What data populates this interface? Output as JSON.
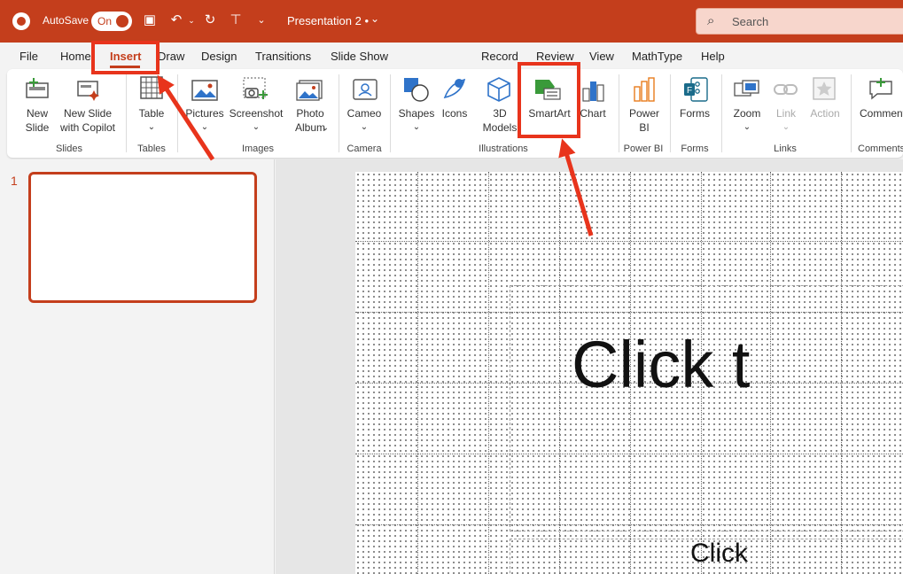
{
  "titlebar": {
    "autosave_label": "AutoSave",
    "autosave_state": "On",
    "title": "Presentation 2 •",
    "search_placeholder": "Search"
  },
  "tabs": [
    {
      "label": "File"
    },
    {
      "label": "Home"
    },
    {
      "label": "Insert",
      "active": true
    },
    {
      "label": "Draw"
    },
    {
      "label": "Design"
    },
    {
      "label": "Transitions"
    },
    {
      "label": "Slide Show"
    },
    {
      "label": "Record"
    },
    {
      "label": "Review"
    },
    {
      "label": "View"
    },
    {
      "label": "MathType"
    },
    {
      "label": "Help"
    }
  ],
  "ribbon": {
    "new_slide": "New\nSlide",
    "new_slide_copilot": "New Slide\nwith Copilot",
    "table": "Table",
    "pictures": "Pictures",
    "screenshot": "Screenshot",
    "photo_album": "Photo\nAlbum",
    "cameo": "Cameo",
    "shapes": "Shapes",
    "icons": "Icons",
    "models_3d": "3D\nModels",
    "smartart": "SmartArt",
    "chart": "Chart",
    "power_bi": "Power\nBI",
    "forms": "Forms",
    "zoom": "Zoom",
    "link": "Link",
    "action": "Action",
    "comment": "Comment",
    "groups": {
      "slides": "Slides",
      "tables": "Tables",
      "images": "Images",
      "camera": "Camera",
      "illustrations": "Illustrations",
      "power_bi": "Power BI",
      "forms": "Forms",
      "links": "Links",
      "comments": "Comments"
    }
  },
  "thumbnails": {
    "slide_number": "1"
  },
  "slide": {
    "title_placeholder": "Click t",
    "subtitle_placeholder": "Click"
  },
  "colors": {
    "accent": "#c43e1c",
    "annotation": "#e8341c"
  }
}
